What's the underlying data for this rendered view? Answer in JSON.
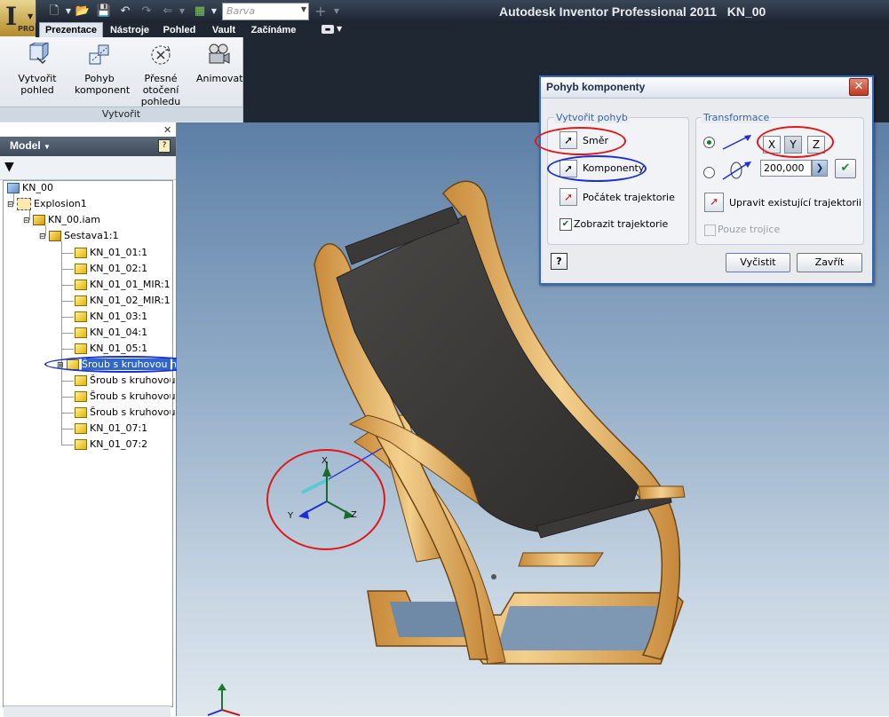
{
  "app": {
    "title": "Autodesk Inventor Professional 2011",
    "document": "KN_00",
    "pro_label": "PRO",
    "color_combo": "Barva"
  },
  "tabs": [
    "Prezentace",
    "Nástroje",
    "Pohled",
    "Vault",
    "Začínáme"
  ],
  "ribbon": {
    "buttons": [
      {
        "label_1": "Vytvořit pohled",
        "label_2": ""
      },
      {
        "label_1": "Pohyb",
        "label_2": "komponent"
      },
      {
        "label_1": "Přesné otočení",
        "label_2": "pohledu"
      },
      {
        "label_1": "Animovat",
        "label_2": ""
      }
    ],
    "group": "Vytvořit"
  },
  "browser": {
    "title": "Model",
    "tree": [
      "KN_00",
      "Explosion1",
      "KN_00.iam",
      "Sestava1:1",
      "KN_01_01:1",
      "KN_01_02:1",
      "KN_01_01_MIR:1",
      "KN_01_02_MIR:1",
      "KN_01_03:1",
      "KN_01_04:1",
      "KN_01_05:1",
      "Šroub s kruhovou h",
      "Šroub s kruhovou h",
      "Šroub s kruhovou h",
      "Šroub s kruhovou h",
      "KN_01_07:1",
      "KN_01_07:2"
    ]
  },
  "dialog": {
    "title": "Pohyb komponenty",
    "group_create": "Vytvořit pohyb",
    "direction": "Směr",
    "components": "Komponenty",
    "path_origin": "Počátek trajektorie",
    "show_path": "Zobrazit trajektorie",
    "show_path_checked": true,
    "group_transform": "Transformace",
    "axis_x": "X",
    "axis_y": "Y",
    "axis_z": "Z",
    "rotation_value": "200,000",
    "edit_path": "Upravit existující trajektorii",
    "triad_only": "Pouze trojice",
    "triad_only_checked": false,
    "clear_button": "Vyčistit",
    "close_button": "Zavřít",
    "help_glyph": "?"
  },
  "triad": {
    "x": "X",
    "y": "Y",
    "z": "Z"
  },
  "colors": {
    "annotation_red": "#e01818",
    "annotation_blue": "#1b2ed6",
    "selection": "#3167c9"
  }
}
